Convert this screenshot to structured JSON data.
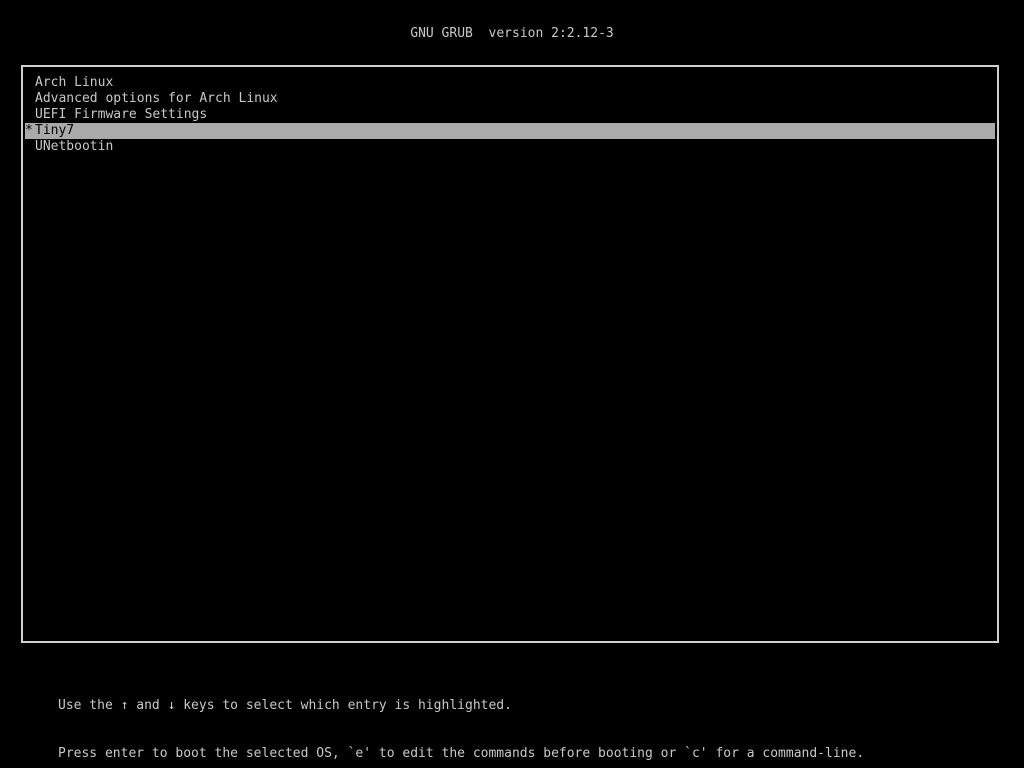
{
  "header": {
    "title": "GNU GRUB  version 2:2.12-3"
  },
  "menu": {
    "items": [
      {
        "label": "Arch Linux",
        "marker": "",
        "selected": false
      },
      {
        "label": "Advanced options for Arch Linux",
        "marker": "",
        "selected": false
      },
      {
        "label": "UEFI Firmware Settings",
        "marker": "",
        "selected": false
      },
      {
        "label": "Tiny7",
        "marker": "*",
        "selected": true
      },
      {
        "label": "UNetbootin",
        "marker": "",
        "selected": false
      }
    ]
  },
  "footer": {
    "line1": "Use the ↑ and ↓ keys to select which entry is highlighted.",
    "line2": "Press enter to boot the selected OS, `e' to edit the commands before booting or `c' for a command-line."
  },
  "colors": {
    "background": "#000000",
    "text": "#c8c8c8",
    "highlight": "#aaaaaa",
    "border": "#cfcfcf"
  }
}
